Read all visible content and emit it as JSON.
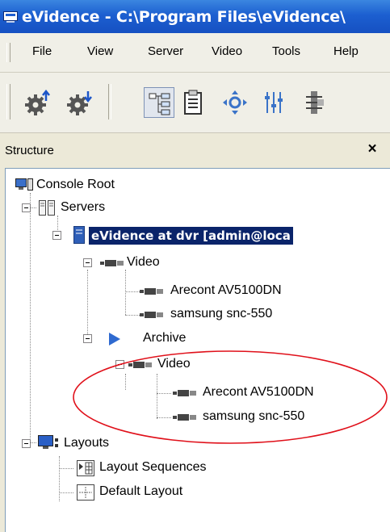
{
  "window": {
    "title": "eVidence - C:\\Program Files\\eVidence\\"
  },
  "menu": [
    "File",
    "View",
    "Server",
    "Video",
    "Tools",
    "Help"
  ],
  "toolbar": {
    "buttons": [
      {
        "icon": "gear-upload-icon"
      },
      {
        "icon": "gear-download-icon"
      },
      {
        "icon": "tree-view-icon",
        "active": true
      },
      {
        "icon": "clipboard-list-icon"
      },
      {
        "icon": "ptz-control-icon"
      },
      {
        "icon": "sliders-icon"
      },
      {
        "icon": "device-config-icon"
      }
    ]
  },
  "panel": {
    "title": "Structure",
    "close": "×"
  },
  "tree": {
    "root": "Console Root",
    "servers": "Servers",
    "server": "eVidence at dvr [admin@loca",
    "video": "Video",
    "camera1": "Arecont AV5100DN",
    "camera2": "samsung snc-550",
    "archive": "Archive",
    "archive_video": "Video",
    "archive_camera1": "Arecont AV5100DN",
    "archive_camera2": "samsung snc-550",
    "layouts": "Layouts",
    "layout_sequences": "Layout Sequences",
    "default_layout": "Default Layout"
  },
  "annotation": {
    "color": "#e0101a"
  }
}
